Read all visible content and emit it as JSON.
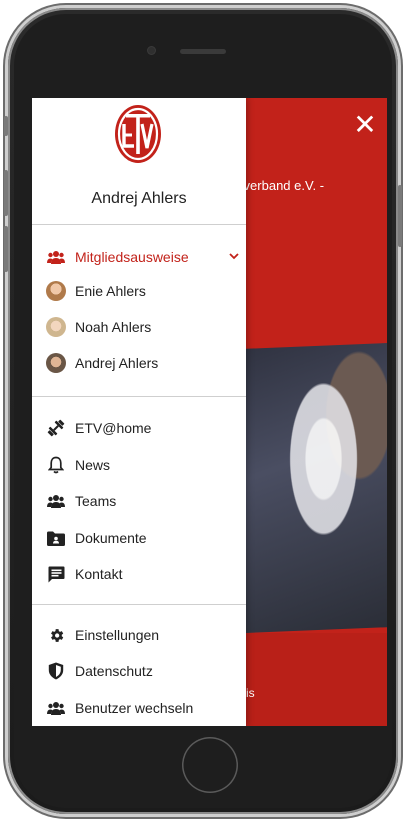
{
  "background": {
    "title": "rnverband e.V. -",
    "footer_fragment": "is"
  },
  "drawer": {
    "user_name": "Andrej Ahlers",
    "sections": {
      "members": {
        "header": "Mitgliedsausweise",
        "members": [
          "Enie Ahlers",
          "Noah Ahlers",
          "Andrej Ahlers"
        ]
      },
      "main": [
        "ETV@home",
        "News",
        "Teams",
        "Dokumente",
        "Kontakt"
      ],
      "settings": [
        "Einstellungen",
        "Datenschutz",
        "Benutzer wechseln"
      ]
    },
    "icons": {
      "members_header": "users-icon",
      "etv_home": "dumbbell-icon",
      "news": "bell-icon",
      "teams": "users-icon",
      "dokumente": "folder-icon",
      "kontakt": "message-icon",
      "einstellungen": "gear-icon",
      "datenschutz": "shield-icon",
      "benutzer_wechseln": "users-icon",
      "close": "close-icon"
    }
  },
  "colors": {
    "accent": "#c2221a",
    "text": "#222222",
    "divider": "#cfcfcf"
  }
}
